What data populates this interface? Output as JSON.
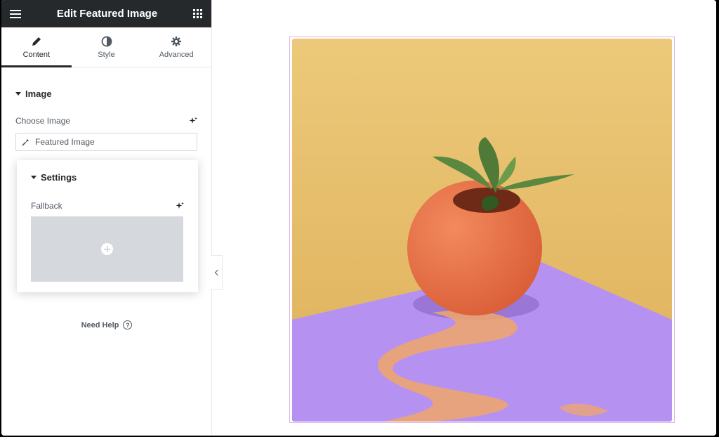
{
  "panel": {
    "title": "Edit Featured Image",
    "menu_icon": "hamburger-icon",
    "apps_icon": "grid-icon",
    "tabs": [
      {
        "label": "Content",
        "icon": "pencil-icon",
        "active": true
      },
      {
        "label": "Style",
        "icon": "contrast-icon",
        "active": false
      },
      {
        "label": "Advanced",
        "icon": "gear-icon",
        "active": false
      }
    ],
    "section_image": "Image",
    "choose_image_label": "Choose Image",
    "dynamic_value": "Featured Image",
    "settings": {
      "heading": "Settings",
      "fallback_label": "Fallback"
    },
    "need_help": "Need Help"
  },
  "colors": {
    "topbar": "#26292c",
    "outline": "#e1b2e8",
    "wall": "#e9c26c",
    "floor": "#b592f2",
    "pot": "#ea7346"
  }
}
